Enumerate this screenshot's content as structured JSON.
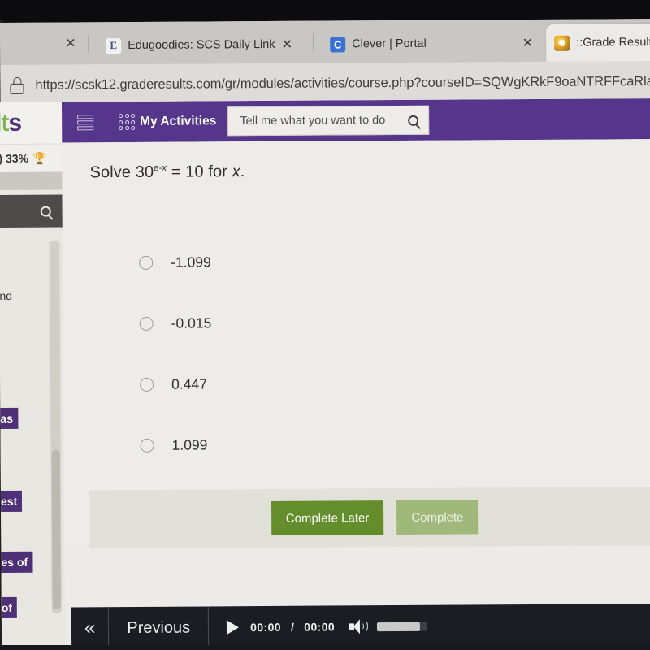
{
  "browser": {
    "tabs": [
      {
        "title": "Edugoodies: SCS Daily Links - ed",
        "favicon": "edugoodies-icon",
        "favicon_letter": "E",
        "close_label": "✕",
        "active": false
      },
      {
        "title": "Clever | Portal",
        "favicon": "clever-icon",
        "favicon_letter": "C",
        "close_label": "✕",
        "active": false
      },
      {
        "title": "::Grade Results",
        "favicon": "grade-results-icon",
        "favicon_letter": "✺",
        "close_label": "✕",
        "active": true
      }
    ],
    "leading_close_label": "✕",
    "url": "https://scsk12.graderesults.com/gr/modules/activities/course.php?courseID=SQWgKRkF9oaNTRFFcaRlaQ",
    "lock_icon": "lock-icon"
  },
  "sidebar": {
    "logo_green": "lt",
    "logo_purple": "s",
    "progress": ")  33%",
    "trophy_icon": "trophy-icon",
    "search_icon": "search-icon",
    "items": [
      {
        "label": "nd",
        "highlighted": false
      },
      {
        "label": "",
        "highlighted": false
      },
      {
        "label": "as",
        "highlighted": true
      },
      {
        "label": "est",
        "highlighted": true
      },
      {
        "label": "es of",
        "highlighted": true
      },
      {
        "label": "of",
        "highlighted": true
      }
    ]
  },
  "toolbar": {
    "menu_icon": "hamburger-menu-icon",
    "apps_icon": "apps-grid-icon",
    "title": "My Activities",
    "search_placeholder": "Tell me what you want to do",
    "search_icon": "search-icon",
    "accent_color": "#53308f"
  },
  "question": {
    "prefix": "Solve 30",
    "exponent": "e-x",
    "suffix": " = 10 for ",
    "variable": "x",
    "period": ".",
    "options": [
      {
        "label": "-1.099",
        "selected": false
      },
      {
        "label": "-0.015",
        "selected": false
      },
      {
        "label": "0.447",
        "selected": false
      },
      {
        "label": "1.099",
        "selected": false
      }
    ]
  },
  "actions": {
    "complete_later_label": "Complete Later",
    "complete_label": "Complete",
    "primary_color": "#5e8c1e",
    "disabled_color": "#9db873"
  },
  "player": {
    "back_icon": "double-chevron-left-icon",
    "back_label": "«",
    "previous_label": "Previous",
    "play_icon": "play-icon",
    "current_time": "00:00",
    "separator": "/",
    "duration": "00:00",
    "volume_icon": "volume-icon",
    "volume_percent": 85
  }
}
